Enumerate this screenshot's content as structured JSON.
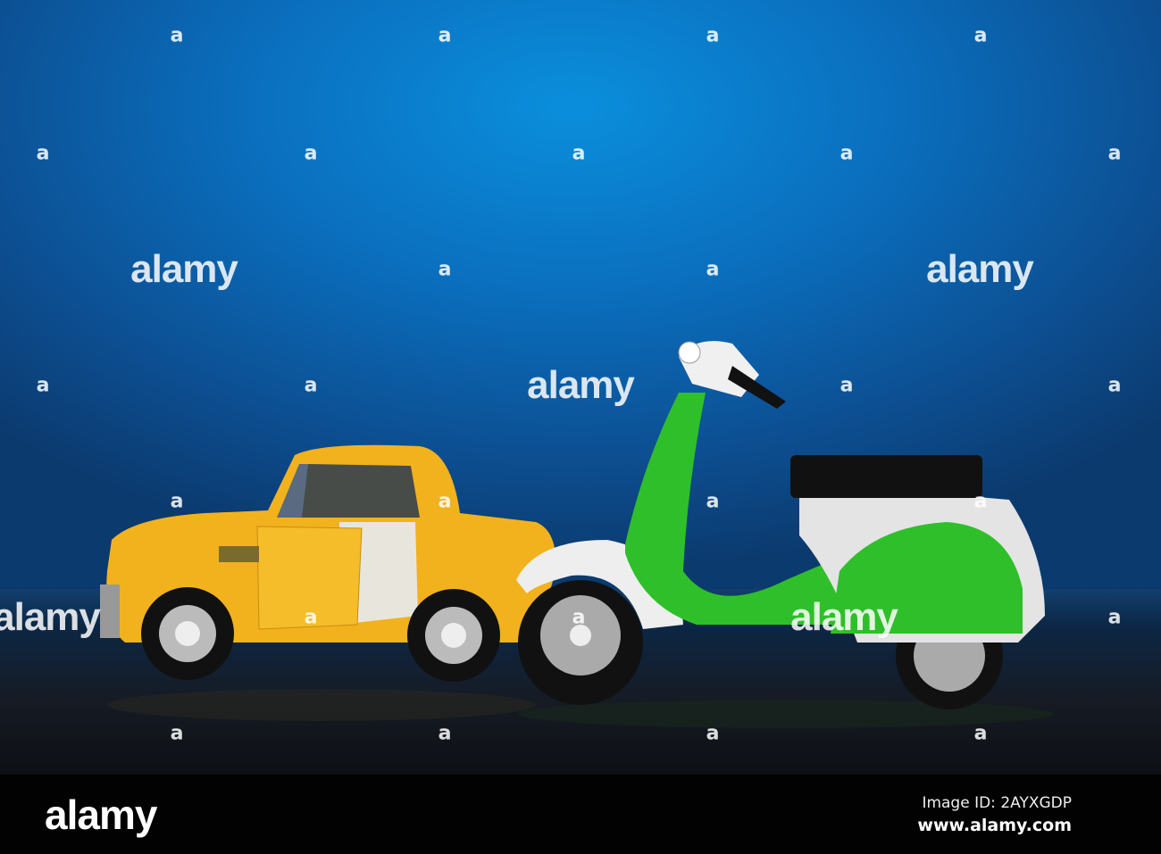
{
  "watermark": {
    "mark": "a",
    "brand": "alamy"
  },
  "footer": {
    "logo": "alamy",
    "image_id": "Image ID: 2AYXGDP",
    "url": "www.alamy.com"
  },
  "colors": {
    "background": "#0a6fbe",
    "car": "#f2b21e",
    "scooter": "#2fbf2a",
    "footer": "#020202"
  }
}
